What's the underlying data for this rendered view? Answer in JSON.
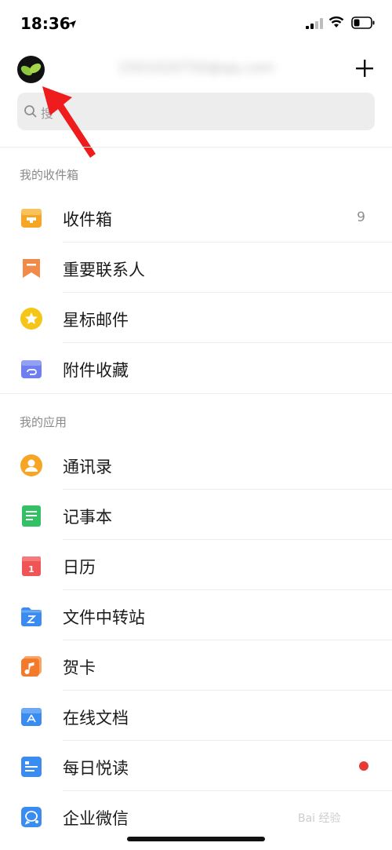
{
  "status_bar": {
    "time": "18:36"
  },
  "header": {
    "account": "1501020750@qq.com",
    "add_label": "+"
  },
  "search": {
    "placeholder": "搜"
  },
  "sections": {
    "mailboxes": {
      "title": "我的收件箱",
      "items": [
        {
          "label": "收件箱",
          "count": "9",
          "icon": "inbox-icon",
          "color": "#f6a524"
        },
        {
          "label": "重要联系人",
          "icon": "bookmark-icon",
          "color": "#f28b4a"
        },
        {
          "label": "星标邮件",
          "icon": "star-icon",
          "color": "#f5c518"
        },
        {
          "label": "附件收藏",
          "icon": "attachment-icon",
          "color": "#6f7ef0"
        }
      ]
    },
    "apps": {
      "title": "我的应用",
      "items": [
        {
          "label": "通讯录",
          "icon": "contacts-icon",
          "color": "#f6a524"
        },
        {
          "label": "记事本",
          "icon": "notes-icon",
          "color": "#34c064"
        },
        {
          "label": "日历",
          "icon": "calendar-icon",
          "color": "#f05454"
        },
        {
          "label": "文件中转站",
          "icon": "folder-icon",
          "color": "#3b8cf0"
        },
        {
          "label": "贺卡",
          "icon": "music-card-icon",
          "color": "#f27a2a"
        },
        {
          "label": "在线文档",
          "icon": "docs-icon",
          "color": "#3b8cf0"
        },
        {
          "label": "每日悦读",
          "icon": "reading-icon",
          "color": "#3b8cf0",
          "badge": "dot"
        },
        {
          "label": "企业微信",
          "icon": "wecom-icon",
          "color": "#3b8cf0"
        }
      ]
    }
  },
  "watermark": "Bai 经验"
}
